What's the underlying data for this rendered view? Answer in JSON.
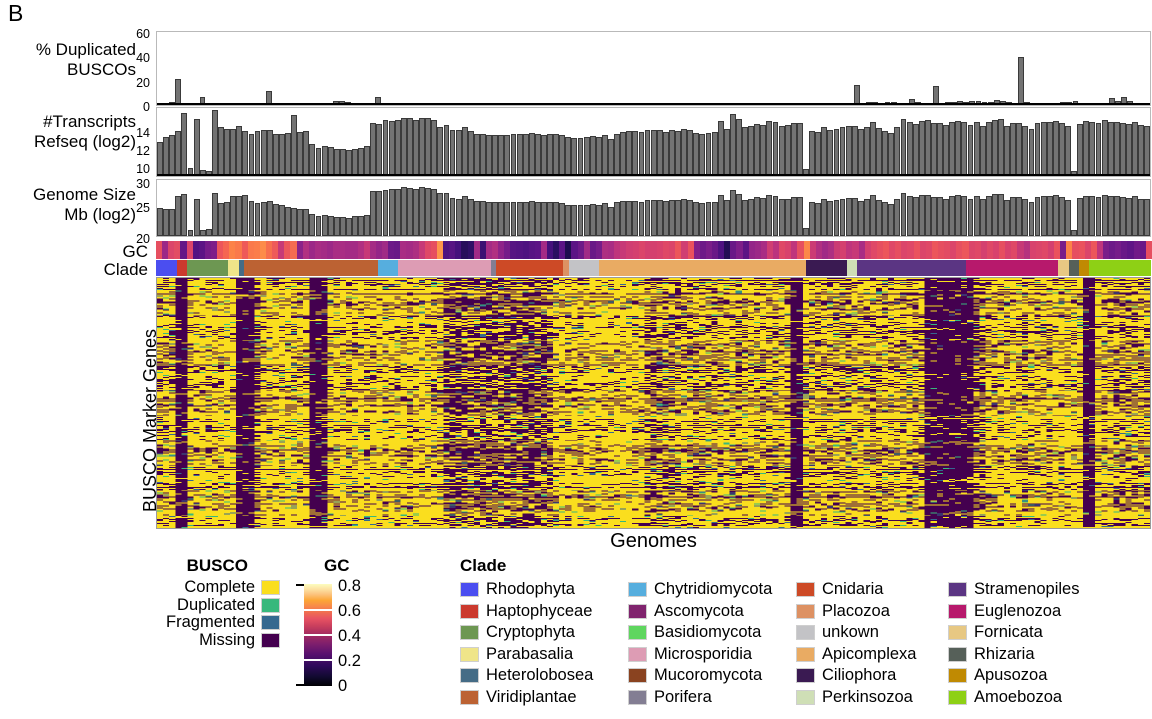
{
  "panel": {
    "letter": "B"
  },
  "axis_labels": {
    "row1": "% Duplicated\nBUSCOs",
    "row2": "#Transcripts\nRefseq (log2)",
    "row3": "Genome Size\nMb (log2)",
    "gc_strip": "GC",
    "clade_strip": "Clade",
    "heatmap_y": "BUSCO Marker Genes",
    "heatmap_x": "Genomes"
  },
  "ticks": {
    "row1": [
      "60",
      "40",
      "20",
      "0"
    ],
    "row2": [
      "14",
      "12",
      "10"
    ],
    "row3": [
      "30",
      "25",
      "20"
    ]
  },
  "legends": {
    "busco": {
      "title": "BUSCO",
      "items": [
        {
          "label": "Complete",
          "color": "#fade1e"
        },
        {
          "label": "Duplicated",
          "color": "#38b87c"
        },
        {
          "label": "Fragmented",
          "color": "#35688f"
        },
        {
          "label": "Missing",
          "color": "#44004f"
        }
      ]
    },
    "gc": {
      "title": "GC",
      "ticks": [
        "0.8",
        "0.6",
        "0.4",
        "0.2",
        "0"
      ],
      "colormap": "magma"
    },
    "clade": {
      "title": "Clade",
      "columns": [
        [
          {
            "label": "Rhodophyta",
            "color": "#4b4ef0"
          },
          {
            "label": "Haptophyceae",
            "color": "#cb3a2e"
          },
          {
            "label": "Cryptophyta",
            "color": "#6d9752"
          },
          {
            "label": "Parabasalia",
            "color": "#efe589"
          },
          {
            "label": "Heterolobosea",
            "color": "#456c86"
          },
          {
            "label": "Viridiplantae",
            "color": "#bc6233"
          }
        ],
        [
          {
            "label": "Chytridiomycota",
            "color": "#56aede"
          },
          {
            "label": "Ascomycota",
            "color": "#80246e"
          },
          {
            "label": "Basidiomycota",
            "color": "#5fd65f"
          },
          {
            "label": "Microsporidia",
            "color": "#dd9cb4"
          },
          {
            "label": "Mucoromycota",
            "color": "#8a4320"
          },
          {
            "label": "Porifera",
            "color": "#837e93"
          }
        ],
        [
          {
            "label": "Cnidaria",
            "color": "#cd4a26"
          },
          {
            "label": "Placozoa",
            "color": "#dd9163"
          },
          {
            "label": "unkown",
            "color": "#c3c3c6"
          },
          {
            "label": "Apicomplexa",
            "color": "#e9ab63"
          },
          {
            "label": "Ciliophora",
            "color": "#3a1a52"
          },
          {
            "label": "Perkinsozoa",
            "color": "#cfdfb6"
          }
        ],
        [
          {
            "label": "Stramenopiles",
            "color": "#5b3583"
          },
          {
            "label": "Euglenozoa",
            "color": "#b7196c"
          },
          {
            "label": "Fornicata",
            "color": "#e7c883"
          },
          {
            "label": "Rhizaria",
            "color": "#566059"
          },
          {
            "label": "Apusozoa",
            "color": "#c08a02"
          },
          {
            "label": "Amoebozoa",
            "color": "#8ed015"
          }
        ]
      ]
    }
  },
  "chart_data": {
    "type": "bar",
    "title": "",
    "xlabel": "Genomes",
    "grid": false,
    "legend_position": "bottom",
    "n_genomes": 163,
    "panels": [
      {
        "id": "duplicated-buscos",
        "type": "bar",
        "ylabel": "% Duplicated BUSCOs",
        "ylim": [
          0,
          60
        ],
        "yticks": [
          0,
          20,
          40,
          60
        ],
        "color": "#737373",
        "values": [
          0.5,
          1.6,
          2.2,
          21.5,
          0.8,
          1.4,
          0.6,
          6.4,
          1.2,
          1.3,
          1.0,
          1.1,
          0.9,
          1.5,
          1.2,
          1.6,
          2.0,
          1.6,
          11.6,
          0.9,
          1.4,
          0.3,
          0.4,
          0.4,
          0.4,
          0.3,
          0.4,
          1.2,
          1.5,
          3.5,
          3.2,
          2.6,
          0.7,
          1.8,
          1.7,
          0.9,
          6.8,
          0.5,
          0.4,
          0.4,
          0.5,
          0.5,
          0.4,
          0.6,
          0.5,
          0.9,
          0.8,
          0.6,
          0.7,
          0.5,
          0.6,
          0.5,
          0.5,
          0.4,
          0.4,
          0.4,
          0.5,
          0.5,
          0.4,
          0.4,
          0.3,
          0.4,
          0.5,
          0.4,
          0.4,
          0.5,
          0.5,
          0.4,
          0.5,
          0.6,
          0.6,
          0.5,
          0.4,
          0.5,
          0.4,
          0.4,
          0.5,
          0.4,
          0.6,
          1.2,
          1.0,
          1.3,
          1.2,
          1.1,
          0.6,
          0.5,
          0.5,
          0.4,
          0.5,
          0.4,
          0.5,
          0.4,
          0.4,
          0.5,
          0.4,
          0.5,
          0.6,
          0.5,
          0.4,
          0.4,
          0.3,
          0.3,
          0.4,
          0.5,
          0.4,
          0.4,
          0.5,
          0.4,
          0.3,
          0.4,
          0.6,
          0.5,
          0.4,
          0.5,
          0.4,
          16.5,
          0.5,
          2.4,
          2.6,
          1.6,
          2.8,
          2.4,
          1.4,
          1.6,
          5.0,
          2.4,
          1.8,
          1.0,
          15.8,
          1.2,
          2.8,
          2.4,
          3.2,
          2.6,
          3.0,
          3.4,
          2.2,
          2.6,
          3.8,
          3.2,
          2.2,
          1.0,
          39.8,
          2.2,
          1.8,
          1.6,
          1.2,
          0.6,
          0.5,
          2.2,
          2.4,
          3.2,
          2.0,
          1.8,
          1.2,
          0.8,
          1.0,
          5.6,
          3.4,
          6.4,
          3.0,
          1.4,
          0.9,
          0.6
        ]
      },
      {
        "id": "transcripts-refseq",
        "type": "bar",
        "ylabel": "#Transcripts Refseq (log2)",
        "ylim": [
          8.6,
          15.6
        ],
        "yticks": [
          10,
          12,
          14
        ],
        "color": "#737373",
        "values": [
          12.1,
          12.6,
          12.8,
          13.2,
          15.1,
          9.4,
          14.5,
          9.2,
          9.1,
          15.4,
          13.6,
          13.4,
          13.4,
          13.7,
          13.2,
          12.9,
          13.2,
          13.3,
          13.3,
          12.9,
          12.9,
          13.0,
          14.9,
          13.1,
          13.2,
          11.9,
          11.5,
          11.7,
          11.6,
          11.4,
          11.4,
          11.3,
          11.4,
          11.5,
          11.7,
          14.1,
          14.0,
          14.4,
          14.3,
          14.4,
          14.6,
          14.6,
          14.4,
          14.6,
          14.6,
          14.4,
          13.6,
          13.9,
          13.3,
          13.3,
          13.6,
          13.2,
          12.9,
          12.9,
          12.8,
          12.8,
          12.8,
          12.8,
          12.9,
          12.9,
          12.9,
          13.0,
          12.9,
          12.8,
          12.9,
          12.9,
          12.8,
          12.6,
          12.5,
          12.5,
          12.6,
          12.7,
          12.6,
          12.8,
          12.4,
          12.9,
          13.1,
          13.2,
          13.2,
          13.1,
          13.3,
          13.3,
          13.3,
          13.1,
          13.3,
          13.2,
          13.4,
          13.3,
          13.0,
          12.9,
          13.0,
          13.1,
          14.3,
          13.4,
          15.0,
          14.5,
          13.6,
          13.7,
          14.0,
          13.9,
          14.3,
          14.2,
          13.8,
          13.9,
          14.1,
          14.1,
          9.3,
          13.2,
          13.1,
          13.6,
          13.3,
          13.4,
          13.6,
          13.7,
          13.7,
          13.4,
          13.6,
          14.2,
          13.5,
          13.2,
          13.0,
          13.6,
          14.5,
          14.2,
          14.0,
          14.3,
          14.4,
          14.1,
          14.1,
          13.9,
          14.2,
          14.3,
          14.2,
          13.9,
          14.2,
          13.8,
          14.2,
          14.4,
          14.5,
          13.7,
          14.1,
          14.1,
          13.8,
          13.4,
          14.1,
          14.2,
          14.2,
          14.3,
          14.1,
          13.7,
          9.1,
          14.0,
          14.3,
          14.2,
          14.1,
          14.4,
          14.2,
          14.2,
          14.1,
          14.0,
          14.2,
          13.9,
          13.7
        ]
      },
      {
        "id": "genome-size",
        "type": "bar",
        "ylabel": "Genome Size Mb (log2)",
        "ylim": [
          17.5,
          30.5
        ],
        "yticks": [
          20,
          25,
          30
        ],
        "color": "#737373",
        "values": [
          24.0,
          23.8,
          23.7,
          26.7,
          27.3,
          19.0,
          26.2,
          18.9,
          19.2,
          27.5,
          25.2,
          25.3,
          26.7,
          26.9,
          27.0,
          25.6,
          25.2,
          25.4,
          25.7,
          25.0,
          24.6,
          24.2,
          24.0,
          23.8,
          23.7,
          22.7,
          22.1,
          22.3,
          22.1,
          21.9,
          21.9,
          21.7,
          22.1,
          22.1,
          22.3,
          27.9,
          28.0,
          28.2,
          28.3,
          28.4,
          28.8,
          28.6,
          28.5,
          28.9,
          28.6,
          28.5,
          27.6,
          27.4,
          26.3,
          26.2,
          26.7,
          26.1,
          25.6,
          25.6,
          25.4,
          25.4,
          25.3,
          25.4,
          25.5,
          25.4,
          25.5,
          25.6,
          25.4,
          25.3,
          25.4,
          25.5,
          25.2,
          24.8,
          24.7,
          24.6,
          24.7,
          25.0,
          24.8,
          25.2,
          24.3,
          25.3,
          25.6,
          25.7,
          25.7,
          25.5,
          25.8,
          25.9,
          25.9,
          25.6,
          25.8,
          25.8,
          26.0,
          25.9,
          25.3,
          25.1,
          25.3,
          25.5,
          27.1,
          25.9,
          28.2,
          27.3,
          25.8,
          26.1,
          26.5,
          26.4,
          27.0,
          26.8,
          26.1,
          26.2,
          26.6,
          26.5,
          19.4,
          25.3,
          25.2,
          26.1,
          25.6,
          25.8,
          26.2,
          26.4,
          26.3,
          25.7,
          26.0,
          27.0,
          25.8,
          25.3,
          24.9,
          26.1,
          27.4,
          26.8,
          26.6,
          27.0,
          27.1,
          26.5,
          26.6,
          26.2,
          26.9,
          27.1,
          26.8,
          26.2,
          26.7,
          26.0,
          26.7,
          27.2,
          27.3,
          25.8,
          26.6,
          26.6,
          26.0,
          25.3,
          26.6,
          26.8,
          26.8,
          27.0,
          26.6,
          25.8,
          18.8,
          26.4,
          26.9,
          26.7,
          26.6,
          27.1,
          26.8,
          26.8,
          26.6,
          26.4,
          26.8,
          26.2,
          26.0
        ]
      }
    ],
    "strips": [
      {
        "id": "gc-strip",
        "label": "GC",
        "type": "heatmap",
        "colormap": "magma",
        "range": [
          0,
          1
        ],
        "values": [
          0.6,
          0.42,
          0.57,
          0.59,
          0.29,
          0.57,
          0.25,
          0.27,
          0.33,
          0.35,
          0.62,
          0.66,
          0.72,
          0.7,
          0.63,
          0.7,
          0.71,
          0.74,
          0.68,
          0.63,
          0.52,
          0.62,
          0.67,
          0.38,
          0.47,
          0.42,
          0.45,
          0.44,
          0.42,
          0.45,
          0.45,
          0.44,
          0.44,
          0.47,
          0.52,
          0.44,
          0.4,
          0.43,
          0.31,
          0.3,
          0.45,
          0.44,
          0.46,
          0.52,
          0.58,
          0.6,
          0.76,
          0.24,
          0.26,
          0.22,
          0.15,
          0.17,
          0.43,
          0.2,
          0.44,
          0.47,
          0.39,
          0.33,
          0.26,
          0.25,
          0.24,
          0.26,
          0.27,
          0.44,
          0.22,
          0.16,
          0.27,
          0.13,
          0.27,
          0.31,
          0.43,
          0.3,
          0.33,
          0.46,
          0.45,
          0.5,
          0.52,
          0.54,
          0.55,
          0.57,
          0.55,
          0.55,
          0.56,
          0.58,
          0.57,
          0.62,
          0.54,
          0.61,
          0.36,
          0.31,
          0.34,
          0.3,
          0.24,
          0.14,
          0.3,
          0.35,
          0.27,
          0.4,
          0.42,
          0.45,
          0.54,
          0.49,
          0.58,
          0.56,
          0.5,
          0.6,
          0.73,
          0.53,
          0.47,
          0.43,
          0.46,
          0.53,
          0.55,
          0.5,
          0.52,
          0.45,
          0.55,
          0.58,
          0.6,
          0.62,
          0.58,
          0.6,
          0.57,
          0.58,
          0.61,
          0.57,
          0.58,
          0.62,
          0.6,
          0.59,
          0.57,
          0.6,
          0.62,
          0.57,
          0.58,
          0.55,
          0.58,
          0.56,
          0.6,
          0.56,
          0.58,
          0.52,
          0.48,
          0.56,
          0.57,
          0.58,
          0.55,
          0.61,
          0.34,
          0.72,
          0.6,
          0.61,
          0.57,
          0.62,
          0.5,
          0.34,
          0.31,
          0.33,
          0.3,
          0.28,
          0.32,
          0.3
        ]
      },
      {
        "id": "clade-strip",
        "label": "Clade",
        "type": "categorical",
        "runs": [
          {
            "clade": "Rhodophyta",
            "color": "#4b4ef0",
            "count": 4
          },
          {
            "clade": "Haptophyceae",
            "color": "#cb3a2e",
            "count": 2
          },
          {
            "clade": "Cryptophyta",
            "color": "#6d9752",
            "count": 8
          },
          {
            "clade": "Parabasalia",
            "color": "#efe589",
            "count": 2
          },
          {
            "clade": "Heterolobosea",
            "color": "#456c86",
            "count": 1
          },
          {
            "clade": "Viridiplantae",
            "color": "#bc6233",
            "count": 26
          },
          {
            "clade": "Chytridiomycota",
            "color": "#56aede",
            "count": 4
          },
          {
            "clade": "Microsporidia",
            "color": "#dd9cb4",
            "count": 18
          },
          {
            "clade": "Porifera",
            "color": "#837e93",
            "count": 1
          },
          {
            "clade": "Cnidaria",
            "color": "#cd4a26",
            "count": 13
          },
          {
            "clade": "Placozoa",
            "color": "#dd9163",
            "count": 1
          },
          {
            "clade": "unkown",
            "color": "#c3c3c6",
            "count": 6
          },
          {
            "clade": "Apicomplexa",
            "color": "#e9ab63",
            "count": 40
          },
          {
            "clade": "Ciliophora",
            "color": "#3a1a52",
            "count": 8
          },
          {
            "clade": "Perkinsozoa",
            "color": "#cfdfb6",
            "count": 2
          },
          {
            "clade": "Stramenopiles",
            "color": "#5b3583",
            "count": 21
          },
          {
            "clade": "Euglenozoa",
            "color": "#b7196c",
            "count": 18
          },
          {
            "clade": "Fornicata",
            "color": "#e7c883",
            "count": 2
          },
          {
            "clade": "Rhizaria",
            "color": "#566059",
            "count": 2
          },
          {
            "clade": "Apusozoa",
            "color": "#c08a02",
            "count": 2
          },
          {
            "clade": "Amoebozoa",
            "color": "#8ed015",
            "count": 12
          }
        ]
      }
    ],
    "heatmap": {
      "id": "busco-marker-heatmap",
      "type": "heatmap",
      "ylabel": "BUSCO Marker Genes",
      "xlabel": "Genomes",
      "n_rows": 255,
      "n_cols": 163,
      "categories": [
        "Complete",
        "Duplicated",
        "Fragmented",
        "Missing"
      ],
      "category_colors": [
        "#fade1e",
        "#38b87c",
        "#35688f",
        "#44004f"
      ]
    }
  }
}
